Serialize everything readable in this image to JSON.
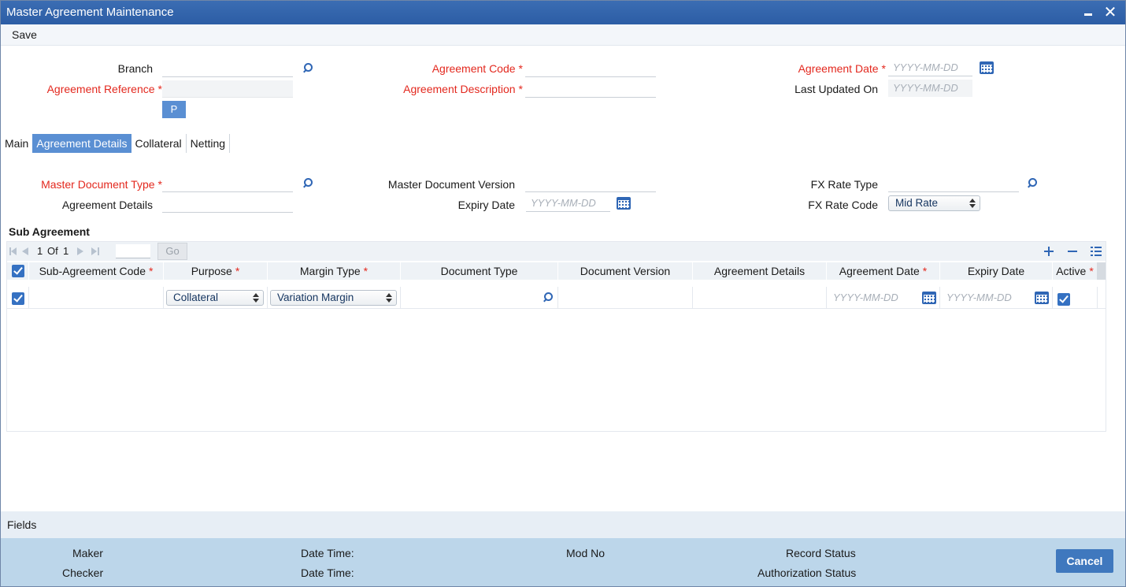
{
  "window": {
    "title": "Master Agreement Maintenance"
  },
  "menu": {
    "save": "Save"
  },
  "header": {
    "branch_label": "Branch",
    "agreement_reference_label": "Agreement Reference",
    "agreement_code_label": "Agreement Code",
    "agreement_description_label": "Agreement Description",
    "agreement_date_label": "Agreement Date",
    "last_updated_label": "Last Updated On",
    "date_placeholder": "YYYY-MM-DD",
    "p_button": "P",
    "required_mark": "*"
  },
  "tabs": [
    "Main",
    "Agreement Details",
    "Collateral",
    "Netting"
  ],
  "details": {
    "master_doc_type_label": "Master Document Type",
    "agreement_details_label": "Agreement Details",
    "master_doc_version_label": "Master Document Version",
    "expiry_date_label": "Expiry Date",
    "fx_rate_type_label": "FX Rate Type",
    "fx_rate_code_label": "FX Rate Code",
    "fx_rate_code_value": "Mid Rate"
  },
  "sub_agreement": {
    "title": "Sub Agreement",
    "pager": {
      "current": "1",
      "of": "Of",
      "total": "1",
      "go": "Go"
    },
    "columns": [
      "Sub-Agreement Code",
      "Purpose",
      "Margin Type",
      "Document Type",
      "Document Version",
      "Agreement Details",
      "Agreement Date",
      "Expiry Date",
      "Active"
    ],
    "row": {
      "purpose": "Collateral",
      "margin_type": "Variation Margin",
      "date_placeholder": "YYYY-MM-DD"
    }
  },
  "fields_bar": {
    "label": "Fields"
  },
  "footer": {
    "maker": "Maker",
    "checker": "Checker",
    "date_time_1": "Date Time:",
    "date_time_2": "Date Time:",
    "mod_no": "Mod No",
    "record_status": "Record Status",
    "authorization_status": "Authorization Status",
    "cancel": "Cancel"
  },
  "colors": {
    "title_bar": "#2c5da5",
    "required": "#e3281e",
    "active_tab": "#5a8fd3",
    "footer": "#bcd6ea",
    "cancel_button": "#3f78be"
  }
}
